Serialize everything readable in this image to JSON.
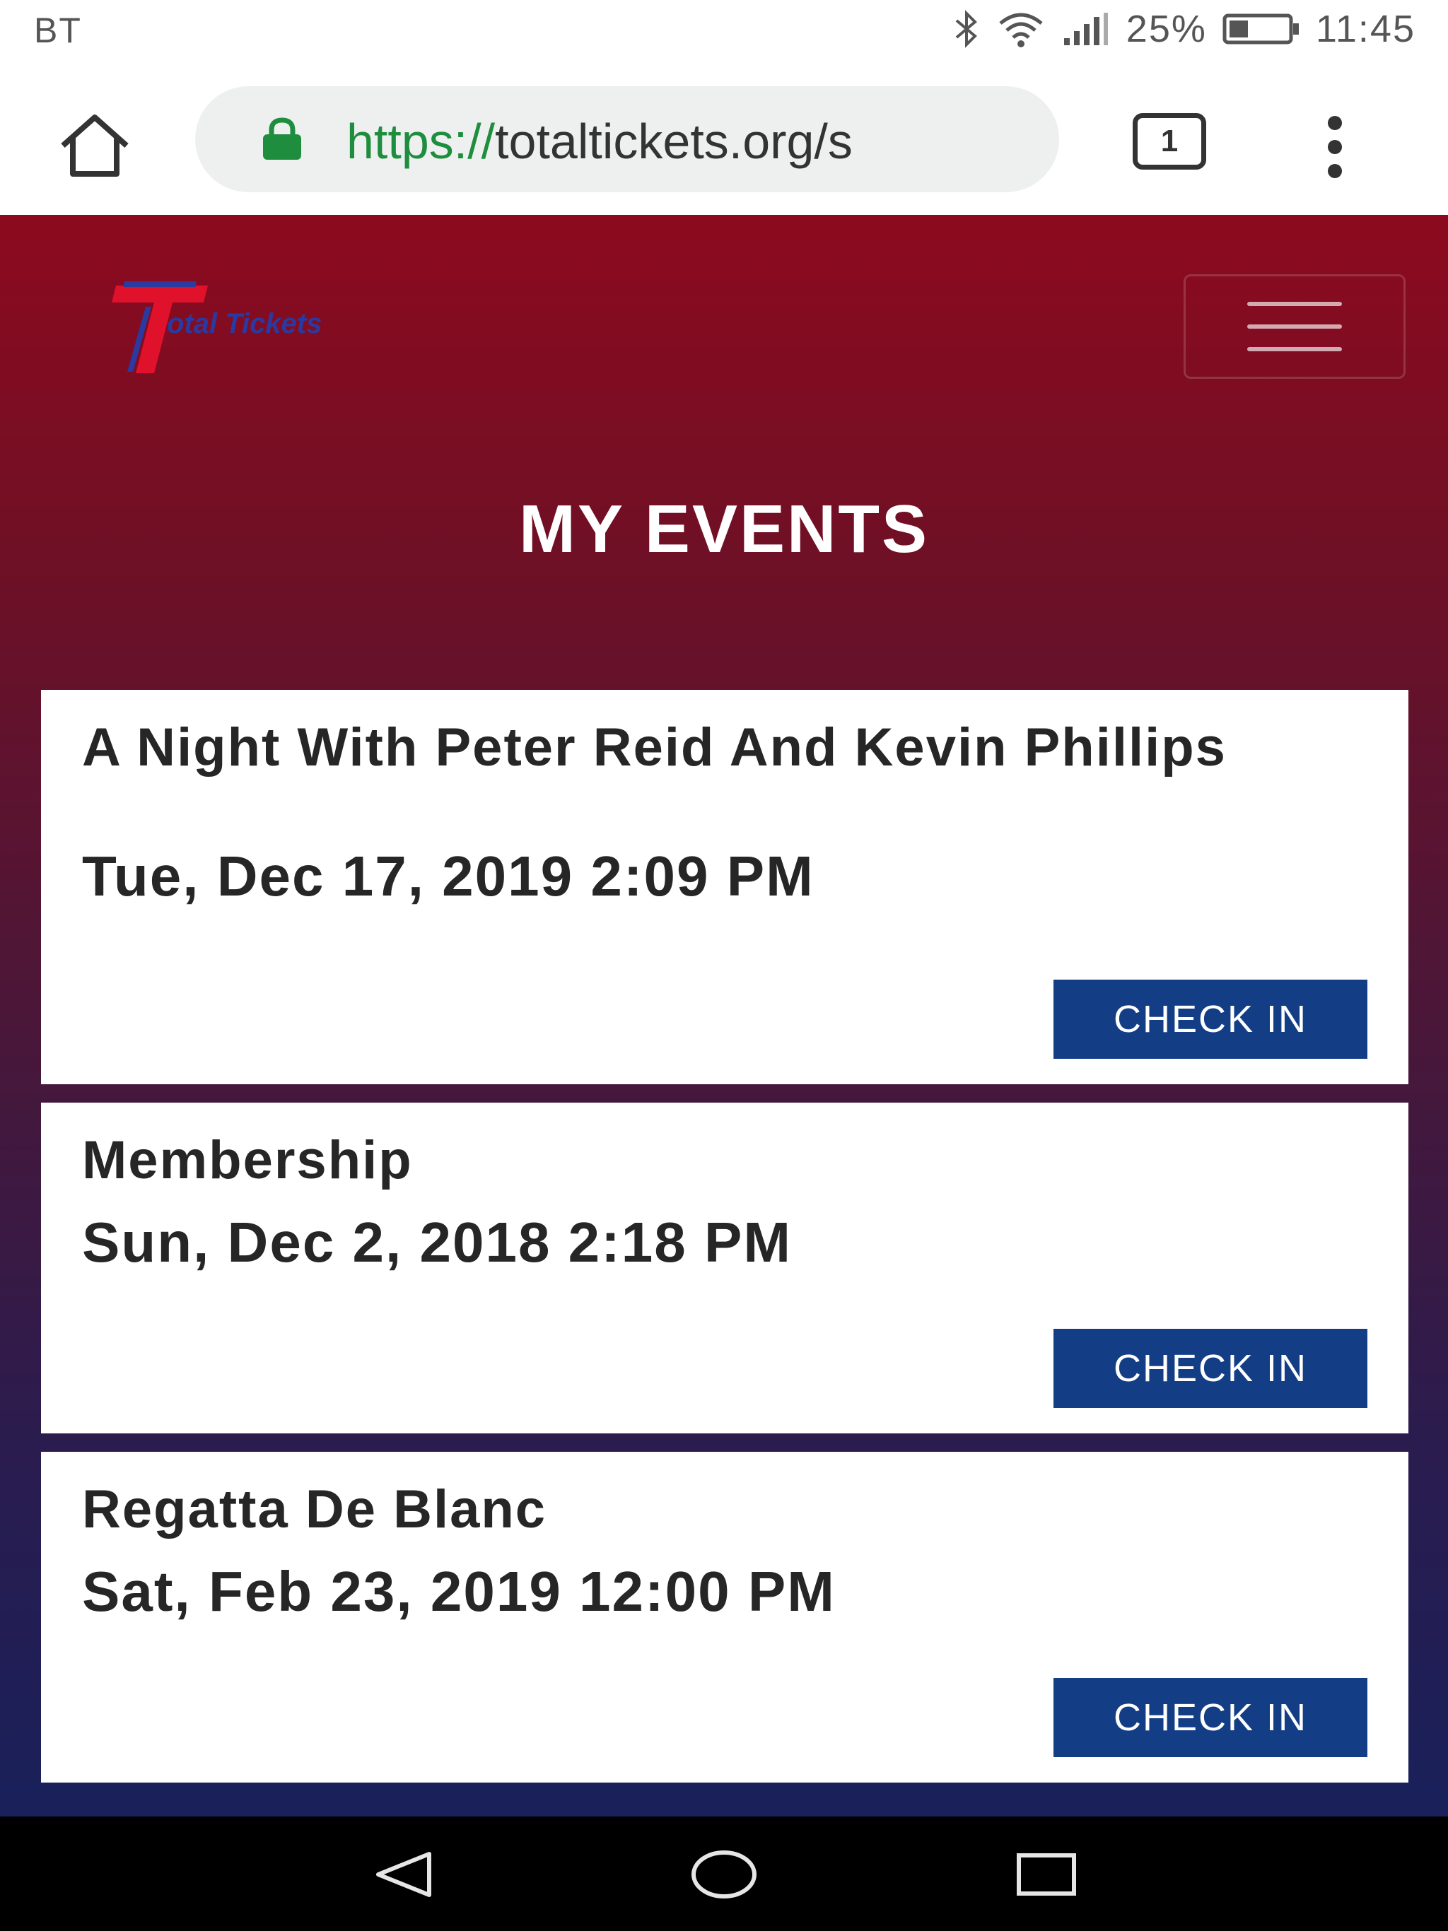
{
  "status_bar": {
    "carrier": "BT",
    "battery": "25%",
    "time": "11:45",
    "icons": [
      "bluetooth-icon",
      "wifi-icon",
      "signal-icon",
      "battery-icon"
    ]
  },
  "browser": {
    "url_scheme": "https://",
    "url_host": "totaltickets.org/s",
    "tab_count": "1",
    "icons": [
      "home-icon",
      "lock-icon",
      "tab-switcher-icon",
      "overflow-menu-icon"
    ]
  },
  "header": {
    "logo_text": "otal Tickets",
    "logo_letter": "T",
    "menu_icon": "hamburger-icon"
  },
  "page": {
    "title": "MY EVENTS"
  },
  "events": [
    {
      "title": "A Night With Peter Reid And Kevin Phillips",
      "date": "Tue, Dec 17, 2019 2:09 PM",
      "button": "CHECK IN"
    },
    {
      "title": "Membership",
      "date": "Sun, Dec 2, 2018 2:18 PM",
      "button": "CHECK IN"
    },
    {
      "title": "Regatta De Blanc",
      "date": "Sat, Feb 23, 2019 12:00 PM",
      "button": "CHECK IN"
    }
  ],
  "nav_bar": {
    "icons": [
      "back-icon",
      "home-circle-icon",
      "recents-icon"
    ]
  },
  "colors": {
    "header_top": "#8d0a1e",
    "header_bottom": "#19205a",
    "button": "#133e86",
    "url_green": "#1e8e3e"
  }
}
